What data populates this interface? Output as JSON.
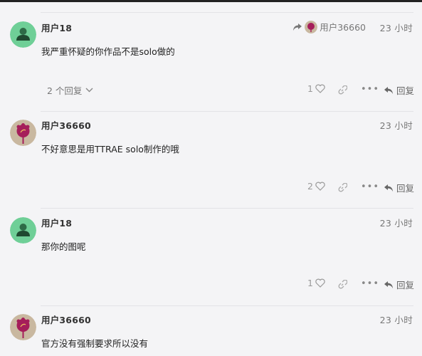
{
  "posts": [
    {
      "username": "用户18",
      "time": "23 小时",
      "content": "我严重怀疑的你作品不是solo做的",
      "reply_to": "用户36660",
      "replies_label": "2 个回复",
      "likes": "1",
      "reply_label": "回复",
      "avatar": "green-person"
    },
    {
      "username": "用户36660",
      "time": "23 小时",
      "content": "不好意思是用TTRAE solo制作的哦",
      "likes": "2",
      "reply_label": "回复",
      "avatar": "flower"
    },
    {
      "username": "用户18",
      "time": "23 小时",
      "content": "那你的图呢",
      "likes": "1",
      "reply_label": "回复",
      "avatar": "green-person"
    },
    {
      "username": "用户36660",
      "time": "23 小时",
      "content": "官方没有强制要求所以没有",
      "avatar": "flower"
    }
  ],
  "icons": {
    "like": "heart-icon",
    "link": "link-icon",
    "more": "more-icon",
    "reply": "reply-icon",
    "expand": "chevron-down-icon",
    "reply_to": "reply-arrow-icon"
  },
  "colors": {
    "green_avatar_bg": "#6fcf97",
    "flower_avatar_bg": "#c9b8a0",
    "flower_color": "#a51e5a"
  }
}
